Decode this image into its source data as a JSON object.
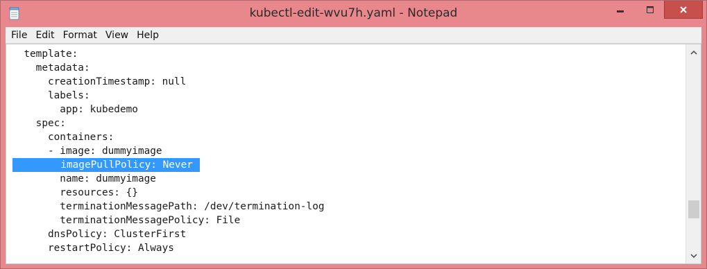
{
  "window": {
    "title": "kubectl-edit-wvu7h.yaml - Notepad"
  },
  "menu": [
    {
      "label": "File"
    },
    {
      "label": "Edit"
    },
    {
      "label": "Format"
    },
    {
      "label": "View"
    },
    {
      "label": "Help"
    }
  ],
  "editor": {
    "lines": [
      {
        "text": "  template:"
      },
      {
        "text": "    metadata:"
      },
      {
        "text": "      creationTimestamp: null"
      },
      {
        "text": "      labels:"
      },
      {
        "text": "        app: kubedemo"
      },
      {
        "text": "    spec:"
      },
      {
        "text": "      containers:"
      },
      {
        "text": "      - image: dummyimage"
      },
      {
        "text": "        imagePullPolicy: Never"
      },
      {
        "text": "        name: dummyimage"
      },
      {
        "text": "        resources: {}"
      },
      {
        "text": "        terminationMessagePath: /dev/termination-log"
      },
      {
        "text": "        terminationMessagePolicy: File"
      },
      {
        "text": "      dnsPolicy: ClusterFirst"
      },
      {
        "text": "      restartPolicy: Always"
      }
    ],
    "selected_line": 8
  },
  "colors": {
    "window_frame": "#e8878c",
    "selection": "#3399ff",
    "close_button": "#c7504c"
  },
  "icons": {
    "app": "notepad-icon",
    "minimize": "minimize-icon",
    "maximize": "maximize-icon",
    "close": "close-icon",
    "scroll_up": "chevron-up-icon",
    "scroll_down": "chevron-down-icon"
  }
}
